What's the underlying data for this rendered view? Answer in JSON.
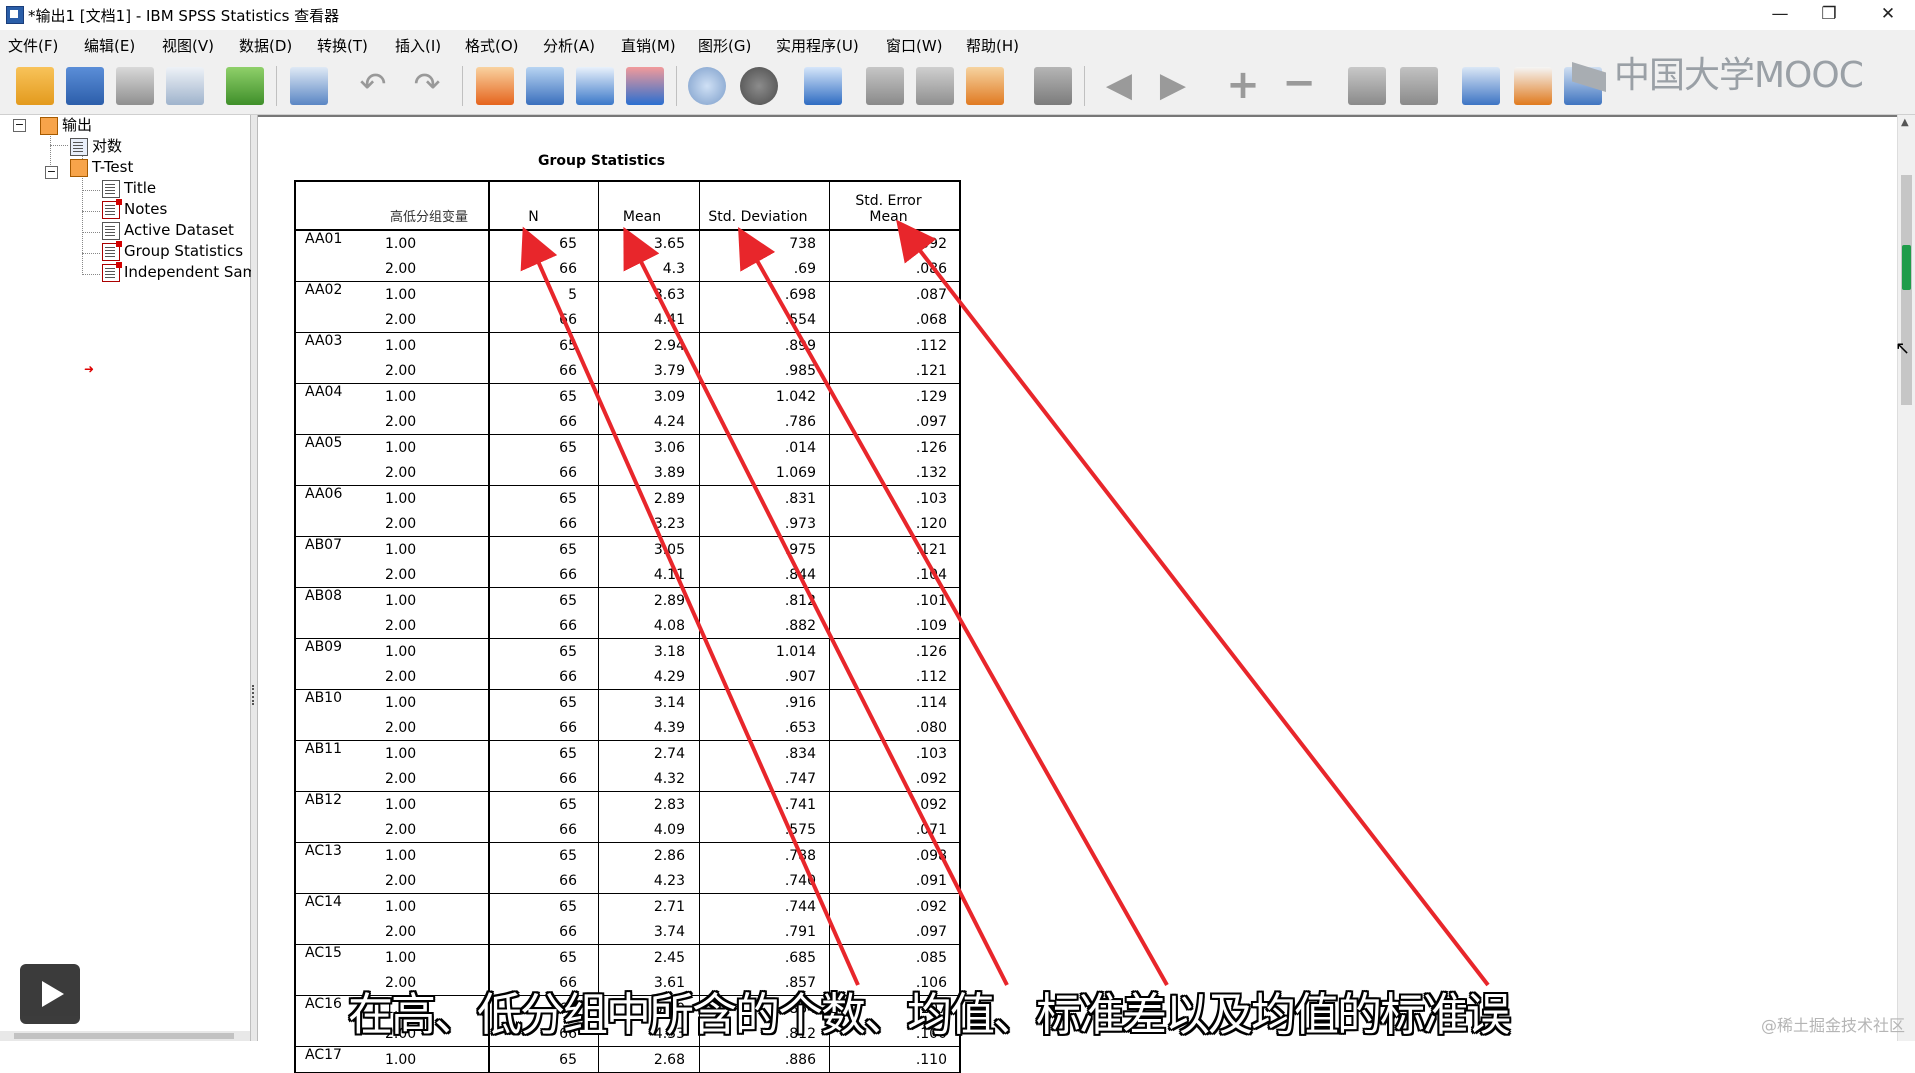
{
  "window": {
    "title": "*输出1 [文档1] - IBM SPSS Statistics 查看器",
    "minimize": "—",
    "restore": "❐",
    "close": "✕"
  },
  "menu": [
    {
      "label": "文件(F)"
    },
    {
      "label": "编辑(E)"
    },
    {
      "label": "视图(V)"
    },
    {
      "label": "数据(D)"
    },
    {
      "label": "转换(T)"
    },
    {
      "label": "插入(I)"
    },
    {
      "label": "格式(O)"
    },
    {
      "label": "分析(A)"
    },
    {
      "label": "直销(M)"
    },
    {
      "label": "图形(G)"
    },
    {
      "label": "实用程序(U)"
    },
    {
      "label": "窗口(W)"
    },
    {
      "label": "帮助(H)"
    }
  ],
  "toolbar_icons": [
    "open-icon",
    "save-icon",
    "print-icon",
    "print-preview-icon",
    "export-icon",
    "goto-data-icon",
    "undo-icon",
    "redo-icon",
    "goto-case-icon",
    "goto-variable-icon",
    "insert-cases-icon",
    "variables-icon",
    "designate-window-icon",
    "select-cases-icon",
    "value-labels-icon",
    "insert-heading-icon",
    "insert-title-icon",
    "insert-text-icon",
    "insert-chart-icon",
    "insert-object-icon",
    "promote-icon",
    "demote-icon",
    "expand-icon",
    "collapse-icon",
    "show-icon",
    "hide-icon",
    "show-all-icon",
    "insert-page-break-icon",
    "scripts-icon"
  ],
  "brand": {
    "logo_text": "中国大学MOOC"
  },
  "tree": {
    "root": "输出",
    "log": "对数",
    "ttest": "T-Test",
    "children": [
      "Title",
      "Notes",
      "Active Dataset",
      "Group Statistics",
      "Independent Sam"
    ]
  },
  "table": {
    "title": "Group Statistics",
    "group_var_header": "高低分组变量",
    "headers": {
      "n": "N",
      "mean": "Mean",
      "sd": "Std. Deviation",
      "se_line1": "Std. Error",
      "se_line2": "Mean"
    },
    "rows": [
      {
        "var": "AA01",
        "groups": [
          [
            "1.00",
            "65",
            "3.65",
            "738",
            ".092"
          ],
          [
            "2.00",
            "66",
            "4.3",
            ".69",
            ".086"
          ]
        ]
      },
      {
        "var": "AA02",
        "groups": [
          [
            "1.00",
            "5",
            "3.63",
            ".698",
            ".087"
          ],
          [
            "2.00",
            "66",
            "4.41",
            ".554",
            ".068"
          ]
        ]
      },
      {
        "var": "AA03",
        "groups": [
          [
            "1.00",
            "65",
            "2.94",
            ".899",
            ".112"
          ],
          [
            "2.00",
            "66",
            "3.79",
            ".985",
            ".121"
          ]
        ]
      },
      {
        "var": "AA04",
        "groups": [
          [
            "1.00",
            "65",
            "3.09",
            "1.042",
            ".129"
          ],
          [
            "2.00",
            "66",
            "4.24",
            ".786",
            ".097"
          ]
        ]
      },
      {
        "var": "AA05",
        "groups": [
          [
            "1.00",
            "65",
            "3.06",
            ".014",
            ".126"
          ],
          [
            "2.00",
            "66",
            "3.89",
            "1.069",
            ".132"
          ]
        ]
      },
      {
        "var": "AA06",
        "groups": [
          [
            "1.00",
            "65",
            "2.89",
            ".831",
            ".103"
          ],
          [
            "2.00",
            "66",
            "3.23",
            ".973",
            ".120"
          ]
        ]
      },
      {
        "var": "AB07",
        "groups": [
          [
            "1.00",
            "65",
            "3.05",
            ".975",
            ".121"
          ],
          [
            "2.00",
            "66",
            "4.11",
            ".844",
            ".104"
          ]
        ]
      },
      {
        "var": "AB08",
        "groups": [
          [
            "1.00",
            "65",
            "2.89",
            ".812",
            ".101"
          ],
          [
            "2.00",
            "66",
            "4.08",
            ".882",
            ".109"
          ]
        ]
      },
      {
        "var": "AB09",
        "groups": [
          [
            "1.00",
            "65",
            "3.18",
            "1.014",
            ".126"
          ],
          [
            "2.00",
            "66",
            "4.29",
            ".907",
            ".112"
          ]
        ]
      },
      {
        "var": "AB10",
        "groups": [
          [
            "1.00",
            "65",
            "3.14",
            ".916",
            ".114"
          ],
          [
            "2.00",
            "66",
            "4.39",
            ".653",
            ".080"
          ]
        ]
      },
      {
        "var": "AB11",
        "groups": [
          [
            "1.00",
            "65",
            "2.74",
            ".834",
            ".103"
          ],
          [
            "2.00",
            "66",
            "4.32",
            ".747",
            ".092"
          ]
        ]
      },
      {
        "var": "AB12",
        "groups": [
          [
            "1.00",
            "65",
            "2.83",
            ".741",
            ".092"
          ],
          [
            "2.00",
            "66",
            "4.09",
            ".575",
            ".071"
          ]
        ]
      },
      {
        "var": "AC13",
        "groups": [
          [
            "1.00",
            "65",
            "2.86",
            ".788",
            ".098"
          ],
          [
            "2.00",
            "66",
            "4.23",
            ".740",
            ".091"
          ]
        ]
      },
      {
        "var": "AC14",
        "groups": [
          [
            "1.00",
            "65",
            "2.71",
            ".744",
            ".092"
          ],
          [
            "2.00",
            "66",
            "3.74",
            ".791",
            ".097"
          ]
        ]
      },
      {
        "var": "AC15",
        "groups": [
          [
            "1.00",
            "65",
            "2.45",
            ".685",
            ".085"
          ],
          [
            "2.00",
            "66",
            "3.61",
            ".857",
            ".106"
          ]
        ]
      },
      {
        "var": "AC16",
        "groups": [
          [
            "1.00",
            "65",
            "3.60",
            ".864",
            ".107"
          ],
          [
            "2.00",
            "66",
            "4.33",
            ".812",
            ".100"
          ]
        ]
      },
      {
        "var": "AC17",
        "groups": [
          [
            "1.00",
            "65",
            "2.68",
            ".886",
            ".110"
          ]
        ]
      }
    ]
  },
  "subtitle": "在高、低分组中所含的个数、均值、标准差以及均值的标准误",
  "watermark": "@稀土掘金技术社区",
  "colors": {
    "arrow": "#e8262b",
    "menu_bg": "#f0f0f0"
  }
}
